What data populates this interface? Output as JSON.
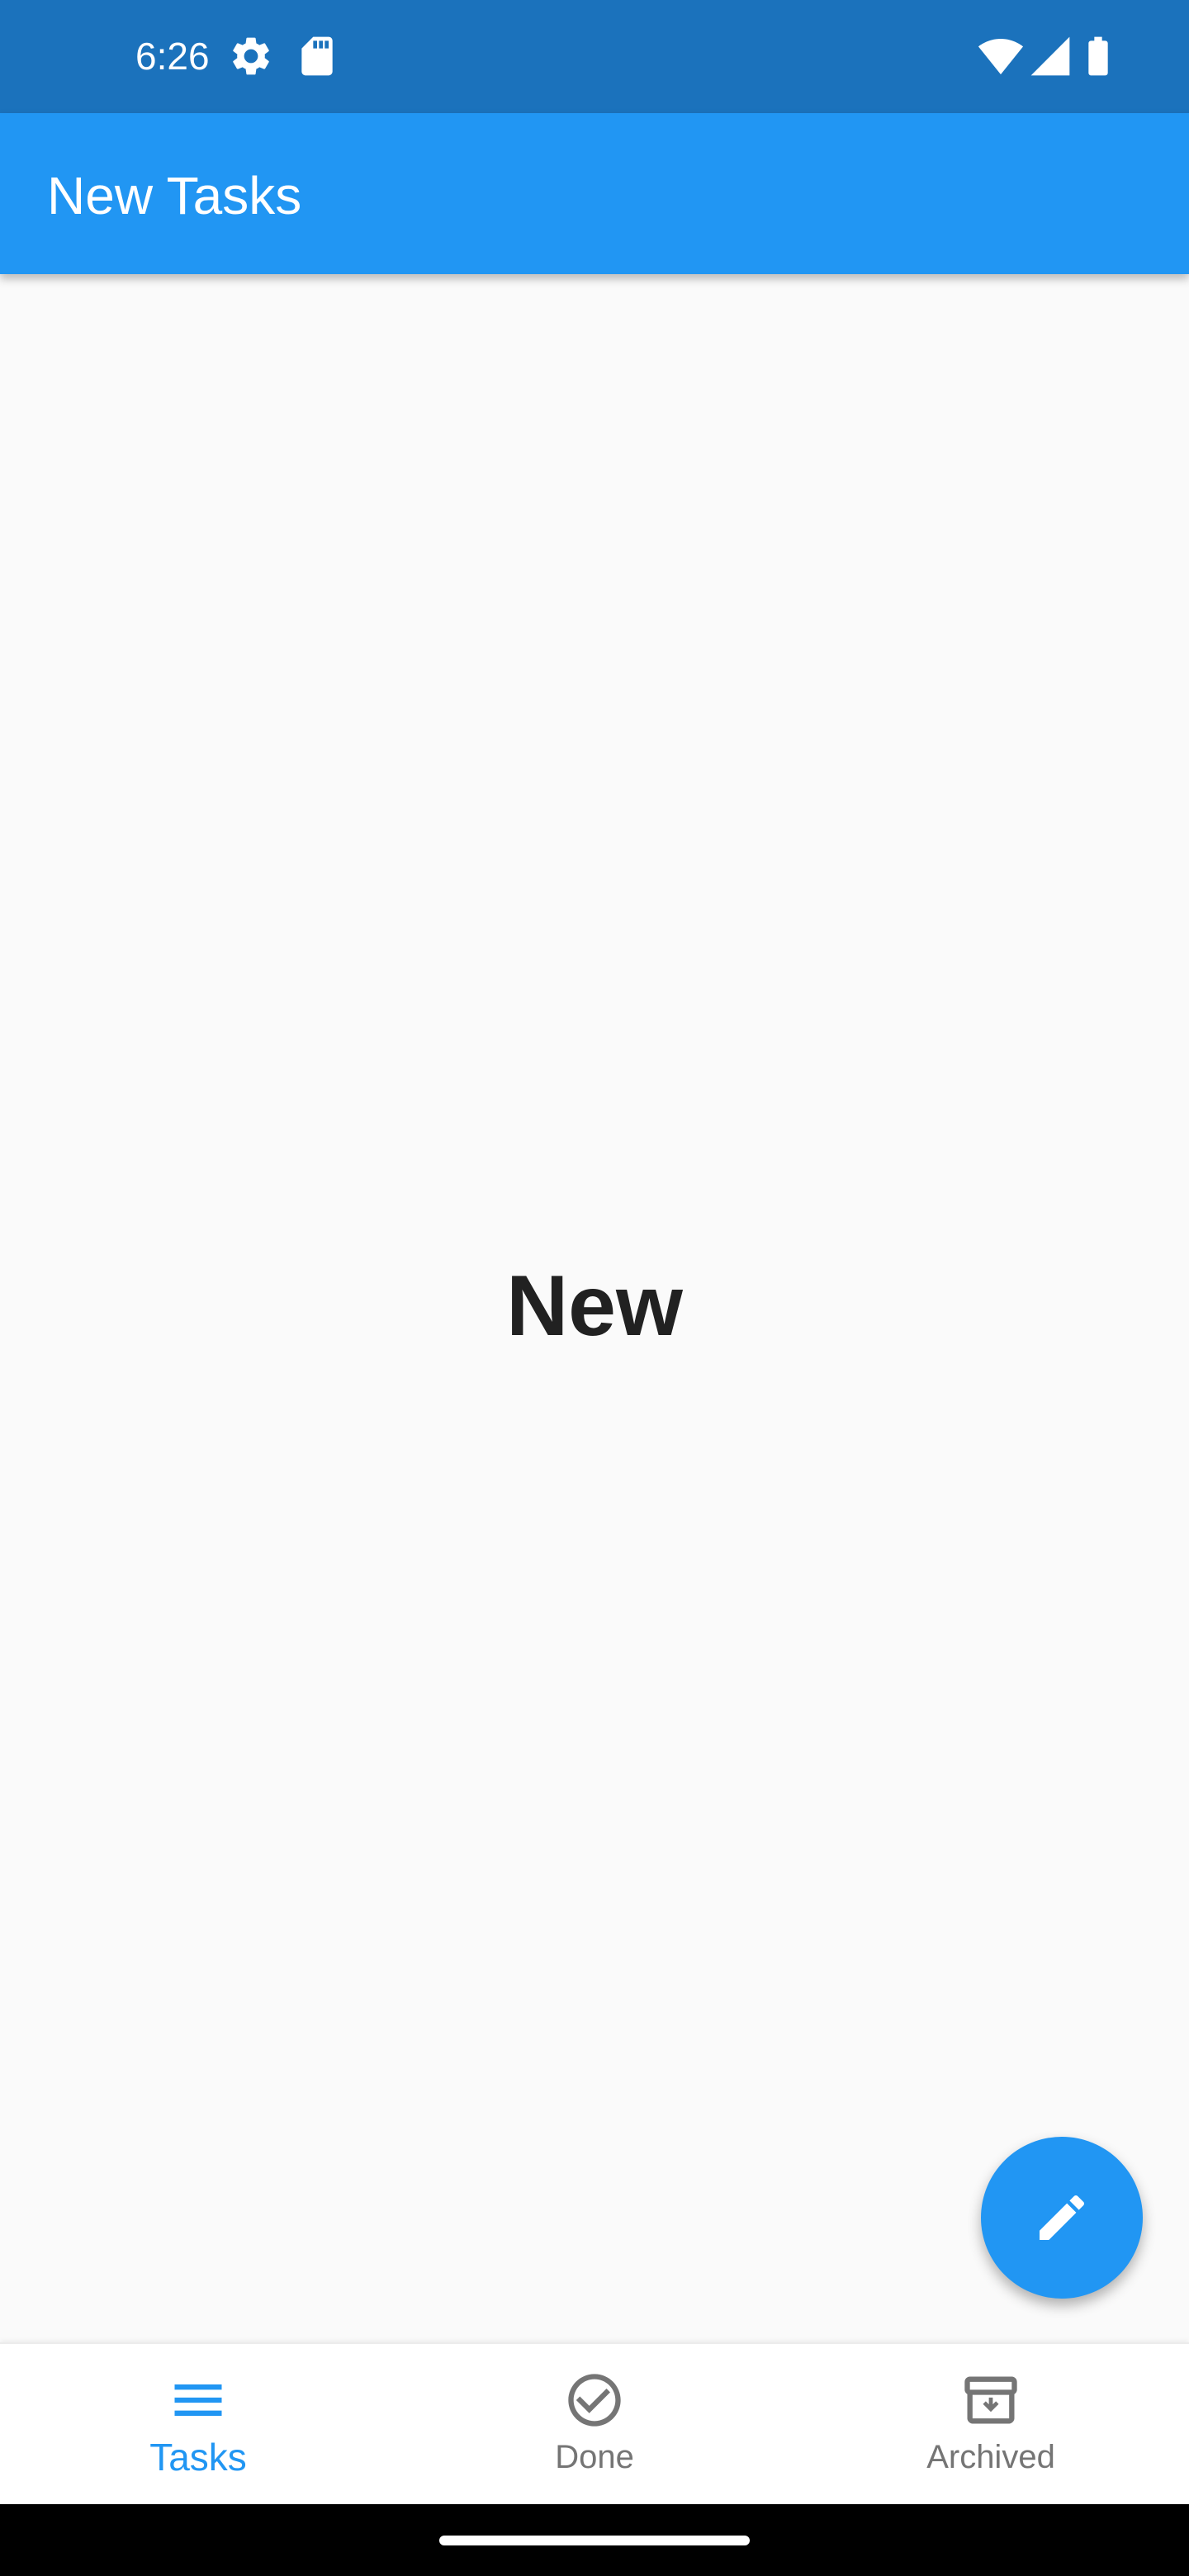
{
  "status_bar": {
    "time": "6:26",
    "icons": [
      "settings-gear-icon",
      "sd-card-icon",
      "wifi-icon",
      "cellular-signal-icon",
      "battery-icon"
    ]
  },
  "app_bar": {
    "title": "New Tasks"
  },
  "main": {
    "center_text": "New"
  },
  "fab": {
    "icon": "pencil-icon"
  },
  "bottom_nav": {
    "items": [
      {
        "label": "Tasks",
        "icon": "menu-lines-icon",
        "active": true
      },
      {
        "label": "Done",
        "icon": "check-circle-icon",
        "active": false
      },
      {
        "label": "Archived",
        "icon": "archive-box-icon",
        "active": false
      }
    ]
  },
  "colors": {
    "status_bar": "#1b72bc",
    "primary": "#2196f3",
    "background": "#fafafa",
    "inactive": "#757575",
    "text": "#212121"
  }
}
